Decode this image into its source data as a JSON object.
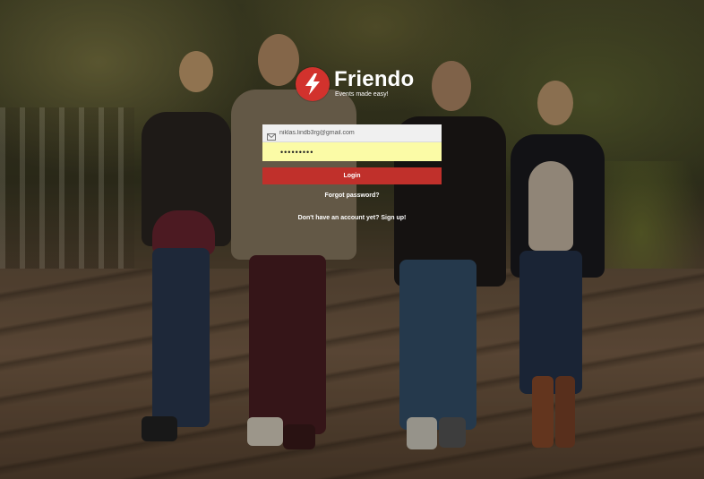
{
  "app": {
    "name": "Friendo",
    "tagline": "Events made easy!",
    "brand_color": "#d2322d"
  },
  "login_form": {
    "email_icon": "envelope-icon",
    "email_value": "niklas.lindb3rg@gmail.com",
    "password_masked": "•••••••••",
    "login_label": "Login",
    "forgot_password_label": "Forgot password?",
    "signup_prompt": "Don't have an account yet?",
    "signup_label": "Sign up!"
  },
  "colors": {
    "login_button": "#c0302b",
    "password_field_bg": "#fbfba6",
    "email_field_bg": "#f0f0f0"
  }
}
